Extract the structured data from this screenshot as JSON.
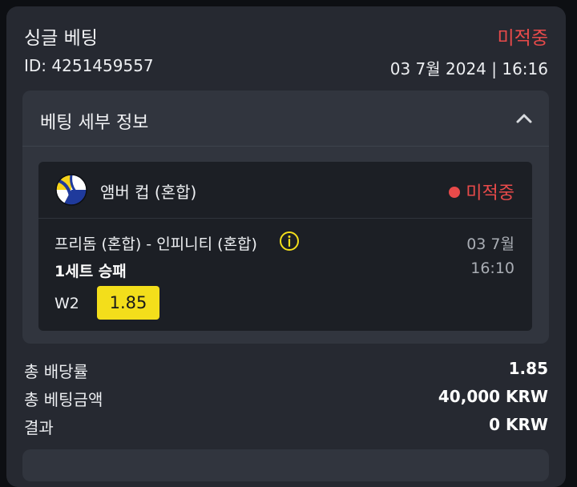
{
  "bet": {
    "type": "싱글 베팅",
    "status": "미적중",
    "id": "ID: 4251459557",
    "datetime": "03 7월 2024 | 16:16"
  },
  "details": {
    "title": "베팅 세부 정보",
    "event": {
      "sport_icon": "volleyball-icon",
      "league": "앰버 컵 (혼합)",
      "status": "미적중",
      "match": "프리돔 (혼합) - 인피니티 (혼합)",
      "date": "03 7월",
      "market": "1세트 승패",
      "time": "16:10",
      "selection": "W2",
      "odds": "1.85"
    }
  },
  "summary": [
    {
      "label": "총 배당률",
      "value": "1.85"
    },
    {
      "label": "총 베팅금액",
      "value": "40,000 KRW"
    },
    {
      "label": "결과",
      "value": "0 KRW"
    }
  ],
  "colors": {
    "status_red": "#e84a4a",
    "odds_yellow": "#f3de1b",
    "card_bg": "#262931",
    "panel_bg": "#31353e",
    "event_bg": "#1c1f25"
  }
}
